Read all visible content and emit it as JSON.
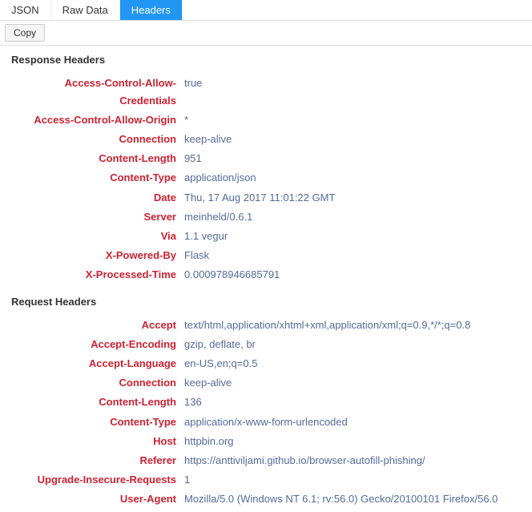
{
  "tabs": {
    "json": "JSON",
    "raw": "Raw Data",
    "headers": "Headers"
  },
  "toolbar": {
    "copy": "Copy"
  },
  "sections": {
    "response": {
      "title": "Response Headers",
      "rows": [
        {
          "name": "Access-Control-Allow-Credentials",
          "value": "true"
        },
        {
          "name": "Access-Control-Allow-Origin",
          "value": "*"
        },
        {
          "name": "Connection",
          "value": "keep-alive"
        },
        {
          "name": "Content-Length",
          "value": "951"
        },
        {
          "name": "Content-Type",
          "value": "application/json"
        },
        {
          "name": "Date",
          "value": "Thu, 17 Aug 2017 11:01:22 GMT"
        },
        {
          "name": "Server",
          "value": "meinheld/0.6.1"
        },
        {
          "name": "Via",
          "value": "1.1 vegur"
        },
        {
          "name": "X-Powered-By",
          "value": "Flask"
        },
        {
          "name": "X-Processed-Time",
          "value": "0.000978946685791"
        }
      ]
    },
    "request": {
      "title": "Request Headers",
      "rows": [
        {
          "name": "Accept",
          "value": "text/html,application/xhtml+xml,application/xml;q=0.9,*/*;q=0.8"
        },
        {
          "name": "Accept-Encoding",
          "value": "gzip, deflate, br"
        },
        {
          "name": "Accept-Language",
          "value": "en-US,en;q=0.5"
        },
        {
          "name": "Connection",
          "value": "keep-alive"
        },
        {
          "name": "Content-Length",
          "value": "136"
        },
        {
          "name": "Content-Type",
          "value": "application/x-www-form-urlencoded"
        },
        {
          "name": "Host",
          "value": "httpbin.org"
        },
        {
          "name": "Referer",
          "value": "https://anttiviljami.github.io/browser-autofill-phishing/"
        },
        {
          "name": "Upgrade-Insecure-Requests",
          "value": "1"
        },
        {
          "name": "User-Agent",
          "value": "Mozilla/5.0 (Windows NT 6.1; rv:56.0) Gecko/20100101 Firefox/56.0"
        }
      ]
    }
  }
}
